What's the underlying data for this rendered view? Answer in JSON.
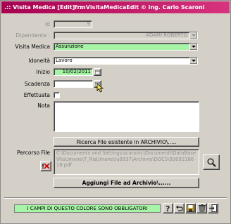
{
  "window": {
    "title_left": ".:: Visita Medica [Edit] ::.",
    "title_right": "frmVisitaMedicaEdit © ing. Carlo Scaroni"
  },
  "form": {
    "id_label": "Id",
    "id_value": "9",
    "dipendente_label": "Dipendente :",
    "dipendente_value": "ADAMI   ROBERTO",
    "visita_label": "Visita Medica",
    "visita_value": "Assunzione",
    "idoneita_label": "Idoneità",
    "idoneita_value": "Lavoro",
    "inizio_label": "Inizio",
    "inizio_value": "10/02/2011",
    "scadenza_label": "Scadenza",
    "scadenza_value": "",
    "effettuata_label": "Effettuata",
    "effettuata_checked": false,
    "nota_label": "Nota",
    "nota_value": ""
  },
  "file": {
    "search_button": "Ricerca File esistente in ARCHIVIO\\.....",
    "path_label": "Percorso File",
    "path_value": "C:\\Documents and Settings\\scaronic\\Documenti\\DataBase\\RisUmane\\T_RisUmane\\lu0937\\Archivio\\DOCS\\9309218618.pdf",
    "add_button": "Aggiungi File ad Archivio\\......"
  },
  "status": {
    "required_note": "I CAMPI DI QUESTO COLORE SONO OBBLIGATORI"
  },
  "colors": {
    "title_start": "#a80050",
    "title_end": "#d8337f",
    "required_green": "#a6f5a6",
    "window_bg": "#d4d0c8"
  }
}
